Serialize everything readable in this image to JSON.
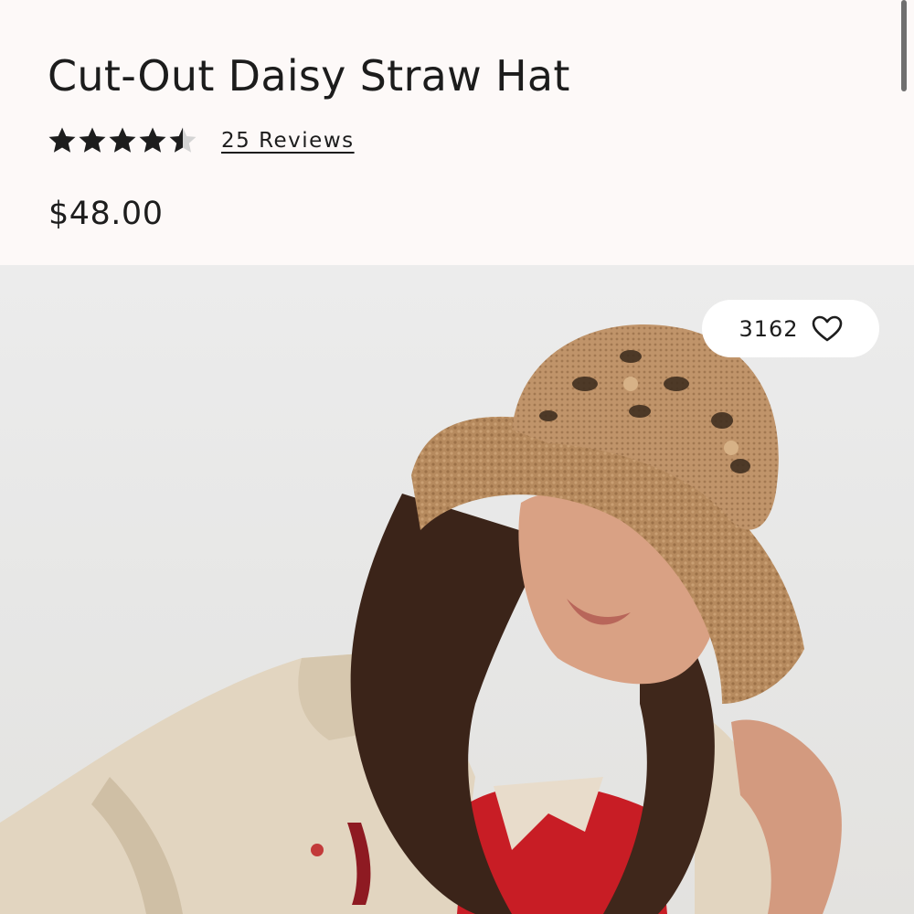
{
  "product": {
    "title": "Cut-Out Daisy Straw Hat",
    "rating": 4.5,
    "rating_max": 5,
    "reviews_label": "25 Reviews",
    "price": "$48.00"
  },
  "image": {
    "alt": "Model wearing crochet straw bucket hat",
    "wishlist_count": "3162"
  },
  "icons": {
    "star": "star-icon",
    "heart": "heart-outline-icon"
  },
  "colors": {
    "text": "#1d1d1d",
    "background": "#fdf9f8",
    "image_background": "#e9e9e8"
  }
}
